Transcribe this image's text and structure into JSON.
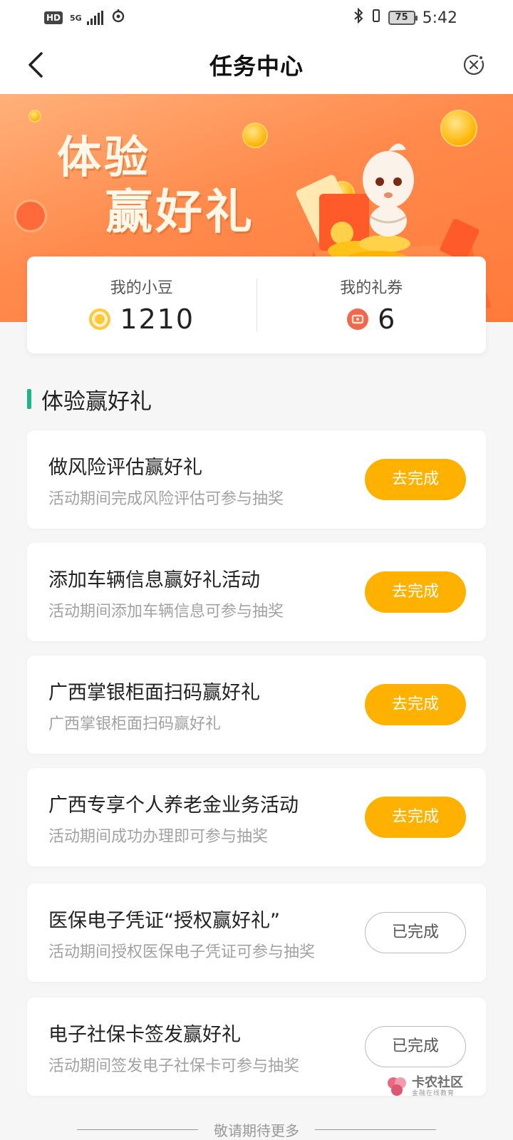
{
  "status_bar": {
    "hd": "HD",
    "network": "5G",
    "battery": "75",
    "time": "5:42"
  },
  "nav": {
    "title": "任务中心"
  },
  "banner": {
    "line1": "体验",
    "line2": "赢好礼"
  },
  "stats": {
    "beans_label": "我的小豆",
    "beans_value": "1210",
    "coupons_label": "我的礼券",
    "coupons_value": "6"
  },
  "section": {
    "title": "体验赢好礼"
  },
  "tasks": [
    {
      "title": "做风险评估赢好礼",
      "desc": "活动期间完成风险评估可参与抽奖",
      "button": "去完成",
      "status": "todo"
    },
    {
      "title": "添加车辆信息赢好礼活动",
      "desc": "活动期间添加车辆信息可参与抽奖",
      "button": "去完成",
      "status": "todo"
    },
    {
      "title": "广西掌银柜面扫码赢好礼",
      "desc": "广西掌银柜面扫码赢好礼",
      "button": "去完成",
      "status": "todo"
    },
    {
      "title": "广西专享个人养老金业务活动",
      "desc": "活动期间成功办理即可参与抽奖",
      "button": "去完成",
      "status": "todo"
    },
    {
      "title": "医保电子凭证“授权赢好礼”",
      "desc": "活动期间授权医保电子凭证可参与抽奖",
      "button": "已完成",
      "status": "done"
    },
    {
      "title": "电子社保卡签发赢好礼",
      "desc": "活动期间签发电子社保卡可参与抽奖",
      "button": "已完成",
      "status": "done"
    }
  ],
  "footer": {
    "text": "敬请期待更多"
  },
  "watermark": {
    "title": "卡农社区",
    "subtitle": "金融在线教育"
  },
  "colors": {
    "accent_button": "#ffb100",
    "section_bar": "#1fb58a",
    "banner_orange": "#ff8a4c"
  },
  "icons": {
    "back": "chevron-left-icon",
    "close": "close-circle-icon",
    "beans": "bean-coin-icon",
    "coupons": "coupon-icon"
  }
}
